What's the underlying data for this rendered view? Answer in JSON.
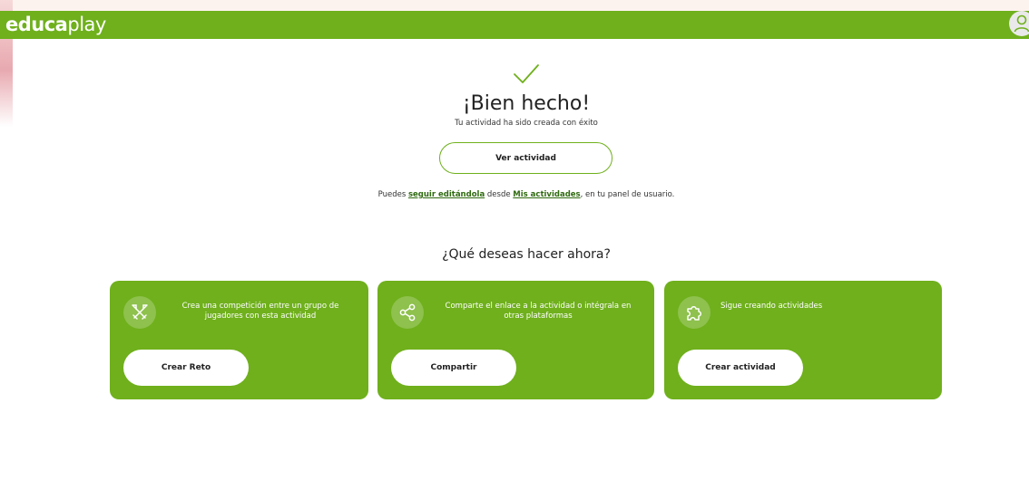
{
  "header": {
    "logo_bold": "educa",
    "logo_light": "play",
    "user_icon": "user-icon"
  },
  "success": {
    "icon": "check-icon",
    "title": "¡Bien hecho!",
    "subtitle": "Tu actividad ha sido creada con éxito",
    "view_button": "Ver actividad"
  },
  "note": {
    "prefix": "Puedes ",
    "link1": "seguir editándola",
    "middle": " desde ",
    "link2": "Mis actividades",
    "suffix": ", en tu panel de usuario."
  },
  "question": "¿Qué deseas hacer ahora?",
  "cards": [
    {
      "icon": "swords-icon",
      "description": "Crea una competición entre un grupo de jugadores con esta actividad",
      "button": "Crear Reto"
    },
    {
      "icon": "share-icon",
      "description": "Comparte el enlace a la actividad o intégrala en otras plataformas",
      "button": "Compartir"
    },
    {
      "icon": "puzzle-icon",
      "description": "Sigue creando actividades",
      "button": "Crear actividad"
    }
  ],
  "colors": {
    "brand_green": "#6fb01c",
    "link_green": "#2f6a10"
  }
}
